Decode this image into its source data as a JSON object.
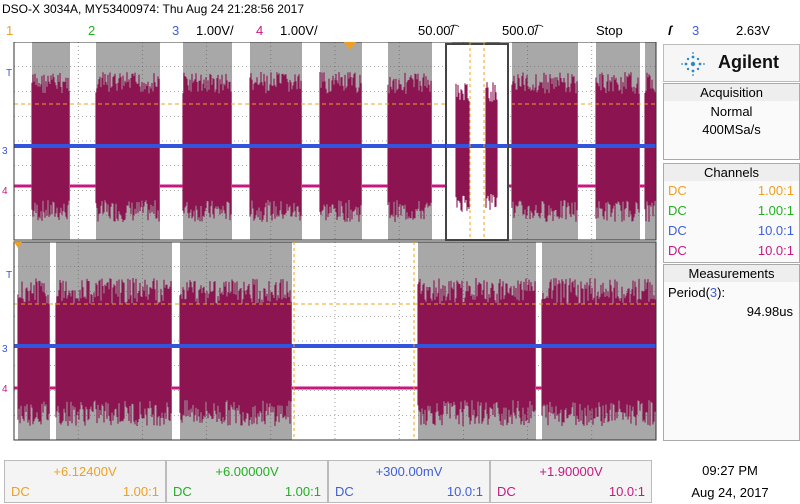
{
  "header": {
    "title": "DSO-X 3034A, MY53400974: Thu Aug 24 21:28:56 2017",
    "ch1_num": "1",
    "ch2_num": "2",
    "ch3_num": "3",
    "ch3_scale": "1.00V/",
    "ch4_num": "4",
    "ch4_scale": "1.00V/",
    "timebase_main": "50.00͡/",
    "timebase_zoom": "500.0͡/",
    "run_state": "Stop",
    "trigger_icon": "ſ",
    "trigger_channel": "3",
    "trigger_level": "2.63V"
  },
  "brand": {
    "name": "Agilent",
    "icon": "sparkle-logo-icon"
  },
  "acquisition": {
    "header": "Acquisition",
    "mode": "Normal",
    "rate": "400MSa/s"
  },
  "channels": {
    "header": "Channels",
    "items": [
      {
        "coupling": "DC",
        "probe": "1.00:1",
        "color": "#f0a020"
      },
      {
        "coupling": "DC",
        "probe": "1.00:1",
        "color": "#20b020"
      },
      {
        "coupling": "DC",
        "probe": "10.0:1",
        "color": "#4060d8"
      },
      {
        "coupling": "DC",
        "probe": "10.0:1",
        "color": "#c81880"
      }
    ]
  },
  "measurements": {
    "header": "Measurements",
    "label": "Period(",
    "channel": "3",
    "label_end": "):",
    "value": "94.98us"
  },
  "bottom_bar": [
    {
      "value": "+6.12400V",
      "coupling": "DC",
      "probe": "1.00:1",
      "color": "#f0a020"
    },
    {
      "value": "+6.00000V",
      "coupling": "DC",
      "probe": "1.00:1",
      "color": "#20b020"
    },
    {
      "value": "+300.00mV",
      "coupling": "DC",
      "probe": "10.0:1",
      "color": "#4060d8"
    },
    {
      "value": "+1.90000V",
      "coupling": "DC",
      "probe": "10.0:1",
      "color": "#c81880"
    }
  ],
  "clock": {
    "time": "09:27 PM",
    "date": "Aug 24, 2017"
  },
  "colors": {
    "ch1": "#f0a020",
    "ch2": "#20b020",
    "ch3": "#3355dd",
    "ch4": "#a0105a",
    "ch4_fill": "#8c1450",
    "grid_bg": "#a8a8a8",
    "zoom_bg": "#ffffff"
  },
  "markers": {
    "ch3": "3",
    "ch4": "4",
    "trigger_level": "T"
  }
}
